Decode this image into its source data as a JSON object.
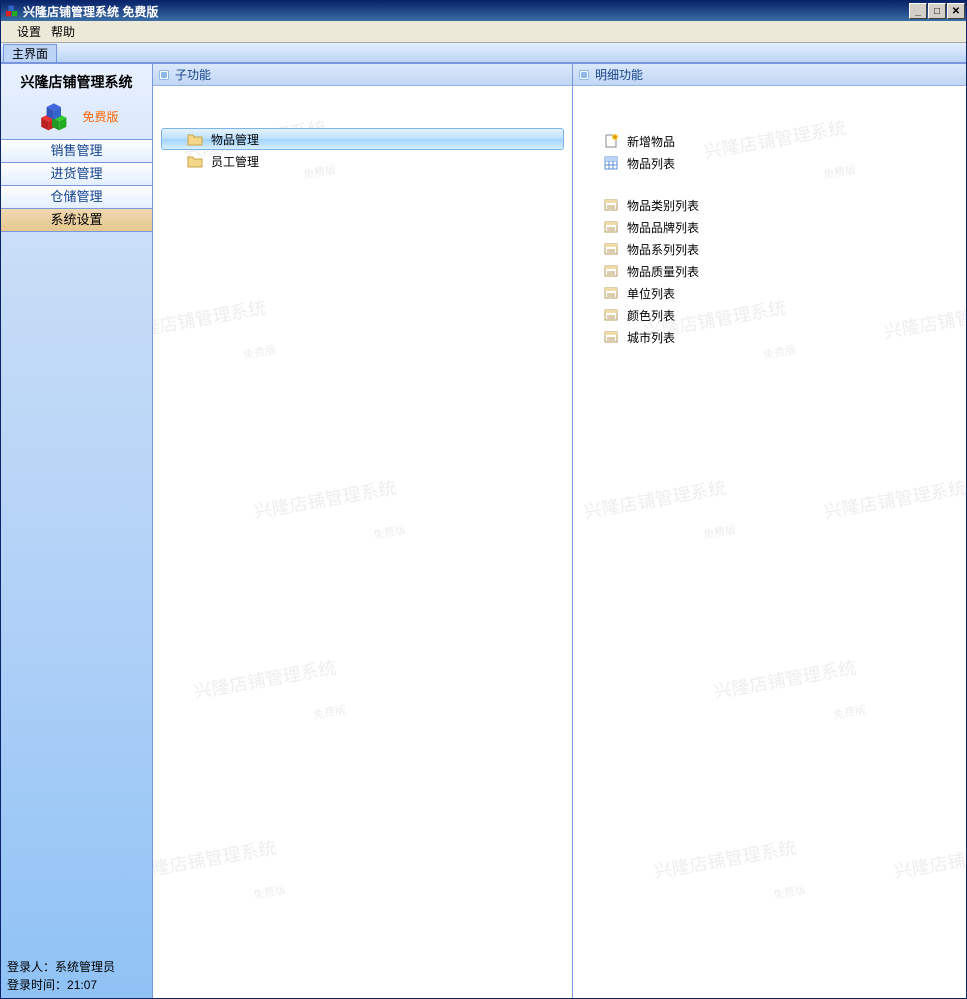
{
  "titlebar": {
    "title": "兴隆店铺管理系统  免费版"
  },
  "menubar": {
    "settings": "设置",
    "help": "帮助"
  },
  "tabs": {
    "main": "主界面"
  },
  "sidebar": {
    "title": "兴隆店铺管理系统",
    "free": "免费版",
    "nav": {
      "sales": "销售管理",
      "purchase": "进货管理",
      "storage": "仓储管理",
      "settings": "系统设置"
    },
    "status_user_label": "登录人：",
    "status_user": "系统管理员",
    "status_time_label": "登录时间：",
    "status_time": "21:07"
  },
  "panels": {
    "sub_title": "子功能",
    "detail_title": "明细功能"
  },
  "sub_items": {
    "goods": "物品管理",
    "staff": "员工管理"
  },
  "detail_items": {
    "add_goods": "新增物品",
    "goods_list": "物品列表",
    "category_list": "物品类别列表",
    "brand_list": "物品品牌列表",
    "series_list": "物品系列列表",
    "quality_list": "物品质量列表",
    "unit_list": "单位列表",
    "color_list": "颜色列表",
    "city_list": "城市列表"
  },
  "watermark": {
    "main": "兴隆店铺管理系统",
    "sub": "免费版"
  }
}
